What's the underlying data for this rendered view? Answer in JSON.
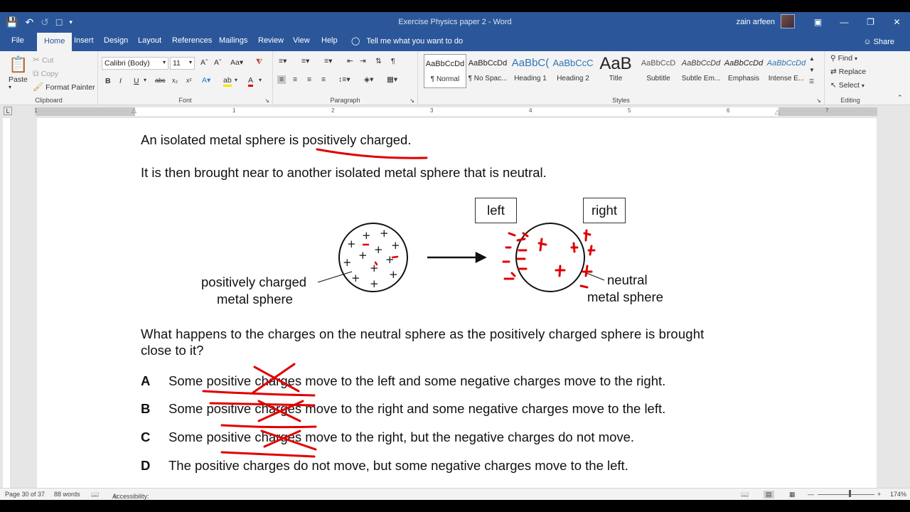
{
  "window": {
    "title": "Exercise Physics paper 2  -  Word",
    "user": "zain arfeen"
  },
  "tabs": [
    "File",
    "Home",
    "Insert",
    "Design",
    "Layout",
    "References",
    "Mailings",
    "Review",
    "View",
    "Help"
  ],
  "tell_me": "Tell me what you want to do",
  "share": "Share",
  "clipboard": {
    "paste": "Paste",
    "cut": "Cut",
    "copy": "Copy",
    "format_painter": "Format Painter",
    "label": "Clipboard"
  },
  "font": {
    "family": "Calibri (Body)",
    "size": "11",
    "label": "Font"
  },
  "paragraph": {
    "label": "Paragraph"
  },
  "styles": {
    "label": "Styles",
    "items": [
      {
        "preview": "AaBbCcDd",
        "name": "¶ Normal"
      },
      {
        "preview": "AaBbCcDd",
        "name": "¶ No Spac..."
      },
      {
        "preview": "AaBbC(",
        "name": "Heading 1"
      },
      {
        "preview": "AaBbCcC",
        "name": "Heading 2"
      },
      {
        "preview": "AaB",
        "name": "Title"
      },
      {
        "preview": "AaBbCcD",
        "name": "Subtitle"
      },
      {
        "preview": "AaBbCcDd",
        "name": "Subtle Em..."
      },
      {
        "preview": "AaBbCcDd",
        "name": "Emphasis"
      },
      {
        "preview": "AaBbCcDd",
        "name": "Intense E..."
      }
    ]
  },
  "editing": {
    "find": "Find",
    "replace": "Replace",
    "select": "Select",
    "label": "Editing"
  },
  "ruler_numbers": [
    "1",
    "1",
    "2",
    "3",
    "4",
    "5",
    "6",
    "7"
  ],
  "document": {
    "line1": "An isolated metal sphere is positively charged.",
    "line2": "It is then brought near to another isolated metal sphere that is neutral.",
    "left_box": "left",
    "right_box": "right",
    "pos_label_1": "positively charged",
    "pos_label_2": "metal sphere",
    "neutral_label_1": "neutral",
    "neutral_label_2": "metal sphere",
    "question_1": "What happens to the charges on the neutral sphere as the positively charged sphere is brought",
    "question_2": "close to it?",
    "options": [
      {
        "letter": "A",
        "text": "Some positive charges move to the left and some negative charges move to the right."
      },
      {
        "letter": "B",
        "text": "Some positive charges move to the right and some negative charges move to the left."
      },
      {
        "letter": "C",
        "text": "Some positive charges move to the right, but the negative charges do not move."
      },
      {
        "letter": "D",
        "text": "The positive charges do not move, but some negative charges move to the left."
      }
    ]
  },
  "status": {
    "page": "Page 30 of 37",
    "words": "88 words",
    "accessibility": "Accessibility: Investigate",
    "zoom": "174%"
  }
}
